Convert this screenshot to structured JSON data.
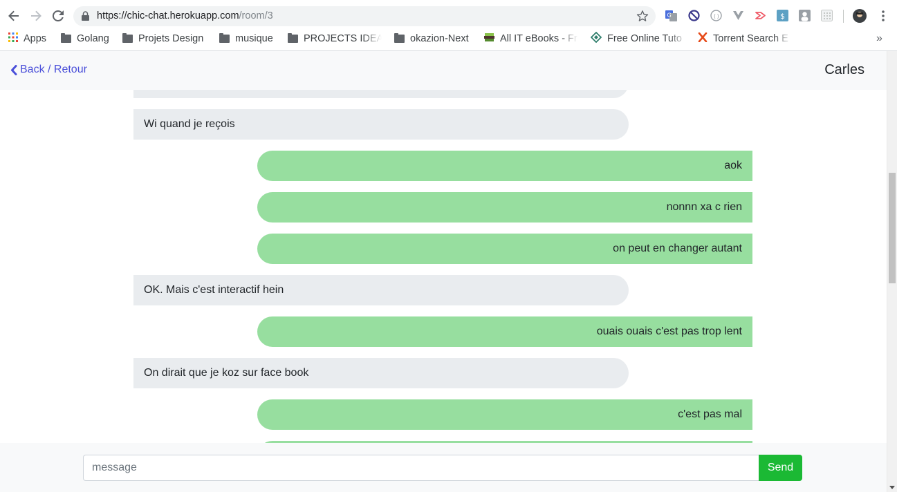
{
  "browser": {
    "url": {
      "host": "https://chic-chat.herokuapp.com",
      "path": "/room/3"
    },
    "bookmarks": [
      {
        "label": "Apps",
        "icon": "apps-grid-icon"
      },
      {
        "label": "Golang",
        "icon": "folder-icon"
      },
      {
        "label": "Projets Design",
        "icon": "folder-icon"
      },
      {
        "label": "musique",
        "icon": "folder-icon"
      },
      {
        "label": "PROJECTS IDEAS",
        "icon": "folder-icon"
      },
      {
        "label": "okazion-Next",
        "icon": "folder-icon"
      },
      {
        "label": "All IT eBooks - Fr",
        "icon": "ebooks-icon"
      },
      {
        "label": "Free Online Tuto",
        "icon": "diamond-icon"
      },
      {
        "label": "Torrent Search E",
        "icon": "x-icon"
      }
    ],
    "overflow_label": "»"
  },
  "header": {
    "back_label": "Back / Retour",
    "contact_name": "Carles"
  },
  "messages": [
    {
      "side": "in",
      "text": "Wi quand je reçois"
    },
    {
      "side": "out",
      "text": "aok"
    },
    {
      "side": "out",
      "text": "nonnn xa c rien"
    },
    {
      "side": "out",
      "text": "on peut en changer autant"
    },
    {
      "side": "in",
      "text": "OK. Mais c'est interactif hein"
    },
    {
      "side": "out",
      "text": "ouais ouais c'est pas trop lent"
    },
    {
      "side": "in",
      "text": "On dirait que je koz sur face book"
    },
    {
      "side": "out",
      "text": "c'est pas mal"
    }
  ],
  "composer": {
    "placeholder": "message",
    "value": "",
    "send_label": "Send"
  },
  "colors": {
    "incoming_bubble": "#e9ecef",
    "outgoing_bubble": "#97de9f",
    "send_button": "#1bb934",
    "link": "#4a4fd9"
  }
}
